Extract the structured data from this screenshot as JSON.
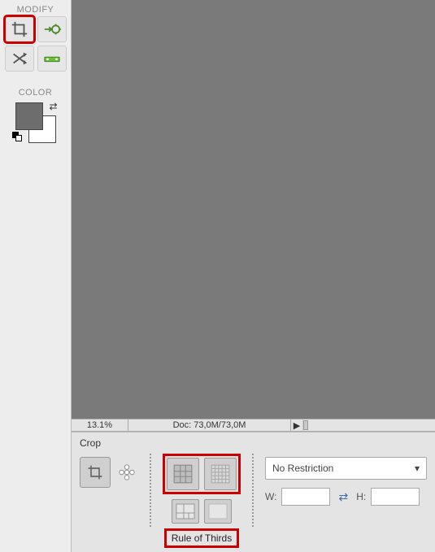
{
  "sidebar": {
    "modify_label": "MODIFY",
    "color_label": "COLOR",
    "colors": {
      "fg": "#6d6d6d",
      "bg": "#ffffff"
    }
  },
  "infobar": {
    "zoom": "13.1%",
    "doc": "Doc: 73,0M/73,0M"
  },
  "crop": {
    "title": "Crop",
    "overlay_label": "Rule of Thirds",
    "aspect": {
      "selected": "No Restriction",
      "w_label": "W:",
      "h_label": "H:",
      "w": "",
      "h": ""
    }
  }
}
